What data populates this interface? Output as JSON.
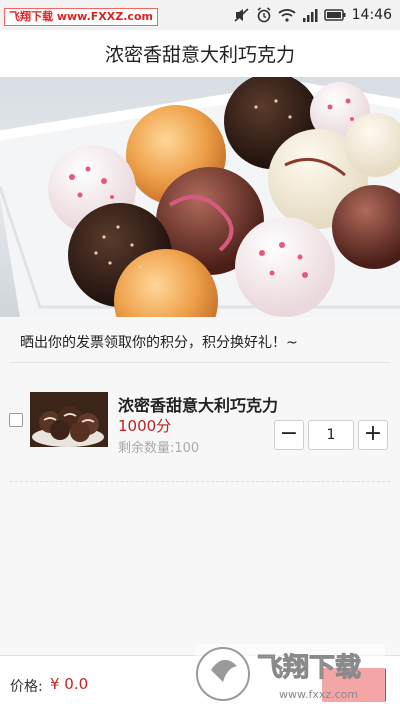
{
  "status_bar": {
    "watermark": "飞翔下载 www.FXXZ.com",
    "time": "14:46"
  },
  "header": {
    "title": "浓密香甜意大利巧克力"
  },
  "banner": {
    "text": "晒出你的发票领取你的积分，积分换好礼！~"
  },
  "product": {
    "name": "浓密香甜意大利巧克力",
    "price": "1000分",
    "stock": "剩余数量:100",
    "quantity": "1",
    "minus": "−",
    "plus": "+"
  },
  "footer": {
    "price_label": "价格:",
    "price_value": "¥ 0.0",
    "watermark_text": "飞翔下载",
    "watermark_url": "www.fxxz.com"
  },
  "colors": {
    "price": "#bb2222",
    "accent": "#e63b3b"
  }
}
